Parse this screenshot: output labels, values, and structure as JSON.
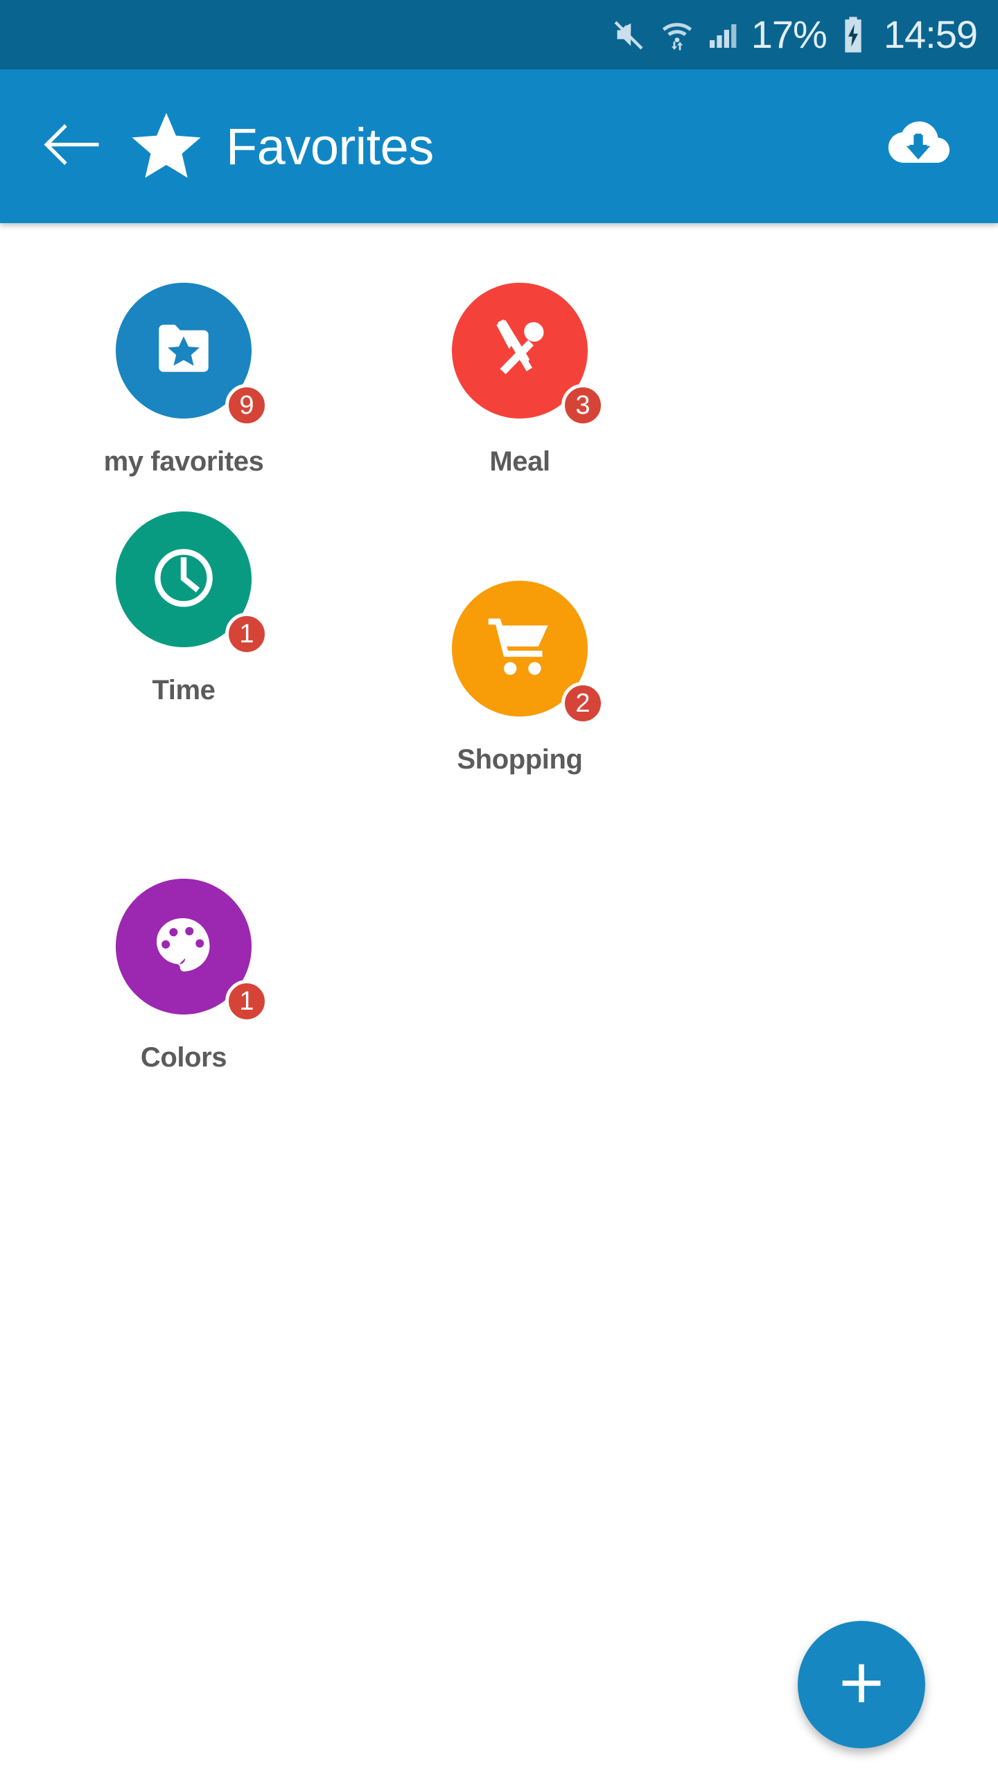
{
  "status_bar": {
    "background": "#0a6490",
    "icons": [
      "mute-icon",
      "wifi-icon",
      "signal-icon",
      "battery-charging-icon"
    ],
    "battery_percent": "17%",
    "time": "14:59"
  },
  "app_bar": {
    "background": "#1087c4",
    "back_icon": "arrow-left-icon",
    "leading_icon": "star-icon",
    "title": "Favorites",
    "action_icon": "cloud-download-icon"
  },
  "categories": [
    {
      "label": "my favorites",
      "badge": "9",
      "color": "#1a85c0",
      "icon": "folder-star-icon"
    },
    {
      "label": "Meal",
      "badge": "3",
      "color": "#f4423a",
      "icon": "cutlery-icon"
    },
    {
      "label": "Time",
      "badge": "1",
      "color": "#089b82",
      "icon": "clock-icon"
    },
    {
      "label": "Shopping",
      "badge": "2",
      "color": "#f89c08",
      "icon": "shopping-cart-icon"
    },
    {
      "label": "Colors",
      "badge": "1",
      "color": "#9c27b0",
      "icon": "palette-icon"
    }
  ],
  "badge_color": "#d64437",
  "fab": {
    "icon": "plus-icon",
    "color": "#1787c2"
  }
}
